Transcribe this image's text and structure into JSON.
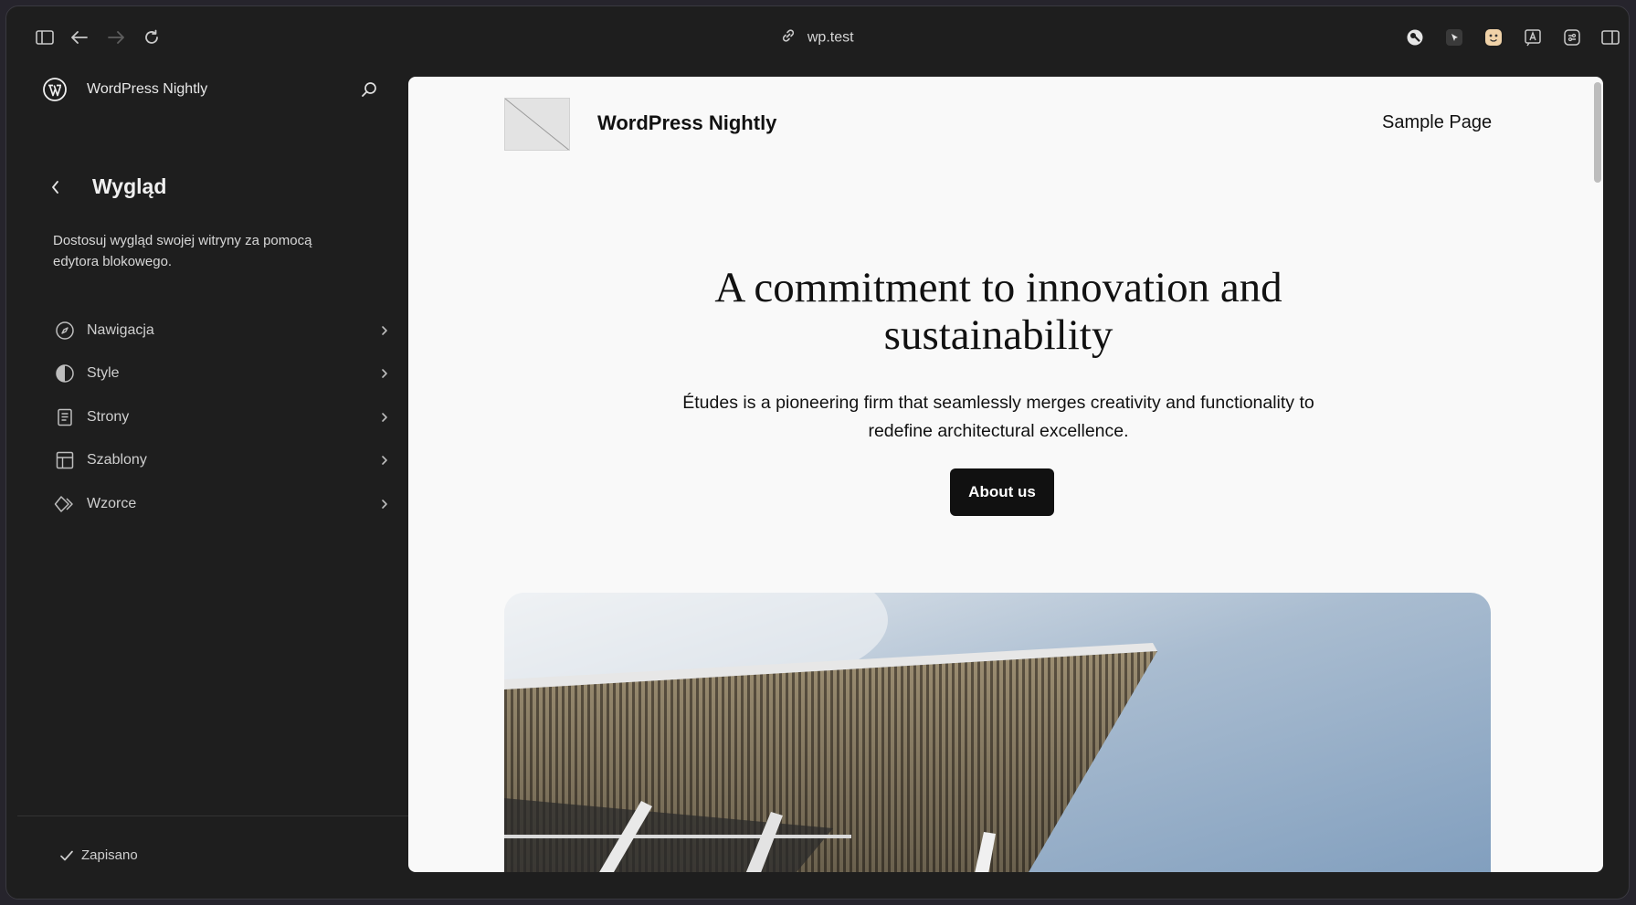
{
  "browser": {
    "url": "wp.test",
    "icons": [
      "sidebar-toggle-icon",
      "back-arrow-icon",
      "forward-arrow-icon",
      "reload-icon",
      "link-icon",
      "password-key-icon",
      "cursor-extension-icon",
      "emoji-extension-icon",
      "translate-extension-icon",
      "settings-sliders-icon",
      "split-view-icon"
    ]
  },
  "sidebar": {
    "site_name": "WordPress Nightly",
    "section_title": "Wygląd",
    "section_description": "Dostosuj wygląd swojej witryny za pomocą edytora blokowego.",
    "items": [
      {
        "label": "Nawigacja",
        "icon": "compass-icon"
      },
      {
        "label": "Style",
        "icon": "half-circle-icon"
      },
      {
        "label": "Strony",
        "icon": "page-icon"
      },
      {
        "label": "Szablony",
        "icon": "layout-icon"
      },
      {
        "label": "Wzorce",
        "icon": "diamond-pattern-icon"
      }
    ],
    "status": "Zapisano"
  },
  "preview": {
    "site_title": "WordPress Nightly",
    "nav_link": "Sample Page",
    "hero_title": "A commitment to innovation and sustainability",
    "hero_text": "Études is a pioneering firm that seamlessly merges creativity and functionality to redefine architectural excellence.",
    "button_label": "About us"
  },
  "colors": {
    "sidebar_bg": "#1e1e1e",
    "preview_bg": "#f9f9f9",
    "button_bg": "#111111"
  }
}
